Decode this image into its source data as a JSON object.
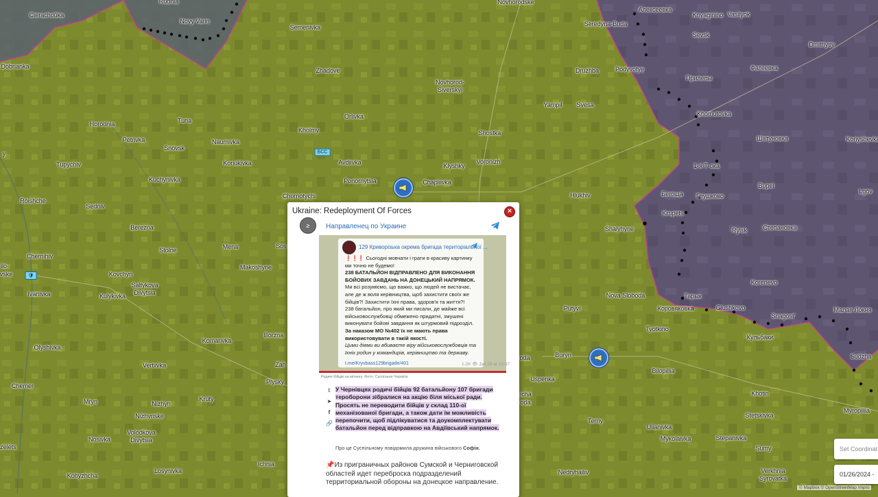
{
  "map": {
    "colors": {
      "ukraine_controlled": "#7d8a2e",
      "russia_area": "#5e5670",
      "border": "#c83a9a",
      "frontline_dots": "#0a0a0a"
    },
    "towns": [
      {
        "name": "Cierachoŭka",
        "cyr": false
      },
      {
        "name": "Rudnia",
        "cyr": false
      },
      {
        "name": "Novy Varin",
        "cyr": false
      },
      {
        "name": "Semenivka",
        "cyr": false
      },
      {
        "name": "Novhorodske",
        "cyr": false
      },
      {
        "name": "Seredyna-Buda",
        "cyr": false
      },
      {
        "name": "Алексеевка",
        "cyr": true
      },
      {
        "name": "Knyaginino",
        "cyr": false
      },
      {
        "name": "Vasilyok",
        "cyr": false
      },
      {
        "name": "Sevsk",
        "cyr": false
      },
      {
        "name": "Dmitriyev",
        "cyr": false
      },
      {
        "name": "Dobrianka",
        "cyr": false
      },
      {
        "name": "Zhadove",
        "cyr": false
      },
      {
        "name": "Novhorod-",
        "cyr": false
      },
      {
        "name": "Siverskyi",
        "cyr": false
      },
      {
        "name": "Druzhba",
        "cyr": false
      },
      {
        "name": "Podyvotye",
        "cyr": false
      },
      {
        "name": "Фатеевка",
        "cyr": true
      },
      {
        "name": "Прилепы",
        "cyr": true
      },
      {
        "name": "Yampil",
        "cyr": false
      },
      {
        "name": "Svesa",
        "cyr": false
      },
      {
        "name": "Khomutovka",
        "cyr": false
      },
      {
        "name": "Orlivka",
        "cyr": false
      },
      {
        "name": "Horodnia",
        "cyr": false
      },
      {
        "name": "Turia",
        "cyr": false
      },
      {
        "name": "Kholmy",
        "cyr": false
      },
      {
        "name": "Shostka",
        "cyr": false
      },
      {
        "name": "Шатуновка",
        "cyr": true
      },
      {
        "name": "Konyshevka",
        "cyr": false
      },
      {
        "name": "Petrivka",
        "cyr": false
      },
      {
        "name": "Naumivka",
        "cyr": false
      },
      {
        "name": "Snovsk",
        "cyr": false
      },
      {
        "name": "Koriukivka",
        "cyr": false
      },
      {
        "name": "Avdiivka",
        "cyr": false
      },
      {
        "name": "Klyshky",
        "cyr": false
      },
      {
        "name": "Voronizh",
        "cyr": false
      },
      {
        "name": "1-я Т·ока",
        "cyr": true
      },
      {
        "name": "Tupychiv",
        "cyr": false
      },
      {
        "name": "Ponornytsia",
        "cyr": false
      },
      {
        "name": "Chapliivka",
        "cyr": false
      },
      {
        "name": "Kuchynivka",
        "cyr": false
      },
      {
        "name": "Bupel",
        "cyr": false
      },
      {
        "name": "Глушково",
        "cyr": true
      },
      {
        "name": "Chornotychi",
        "cyr": false
      },
      {
        "name": "Hlukhiv",
        "cyr": false
      },
      {
        "name": "Бегоща",
        "cyr": true
      },
      {
        "name": "Lgov",
        "cyr": false
      },
      {
        "name": "Roishche",
        "cyr": false
      },
      {
        "name": "Sedniv",
        "cyr": false
      },
      {
        "name": "Krupets",
        "cyr": false
      },
      {
        "name": "Rylsk",
        "cyr": false
      },
      {
        "name": "Berezna",
        "cyr": false
      },
      {
        "name": "Shalyhyne",
        "cyr": false
      },
      {
        "name": "Степановка",
        "cyr": true
      },
      {
        "name": "Chernihiv",
        "cyr": false
      },
      {
        "name": "Mena",
        "cyr": false
      },
      {
        "name": "Sos",
        "cyr": false
      },
      {
        "name": "Stolne",
        "cyr": false
      },
      {
        "name": "Kovchyn",
        "cyr": false
      },
      {
        "name": "Makoshyne",
        "cyr": false
      },
      {
        "name": "Saltykova",
        "cyr": false
      },
      {
        "name": "Divytsia",
        "cyr": false
      },
      {
        "name": "Kulykivka",
        "cyr": false
      },
      {
        "name": "Ivanivka",
        "cyr": false
      },
      {
        "name": "Korenevo",
        "cyr": false
      },
      {
        "name": "Nova Sloboda",
        "cyr": false
      },
      {
        "name": "Тарык",
        "cyr": true
      },
      {
        "name": "Glushkovo",
        "cyr": false
      },
      {
        "name": "Putyvl",
        "cyr": false
      },
      {
        "name": "Коровяковка",
        "cyr": true
      },
      {
        "name": "Малая Локня",
        "cyr": true
      },
      {
        "name": "Snagost'",
        "cyr": false
      },
      {
        "name": "Кульбаки",
        "cyr": true
      },
      {
        "name": "Tyotkino",
        "cyr": false
      },
      {
        "name": "Olyshivka",
        "cyr": false
      },
      {
        "name": "Komarivka",
        "cyr": false
      },
      {
        "name": "Borzna",
        "cyr": false
      },
      {
        "name": "Zah",
        "cyr": false
      },
      {
        "name": "Vertiivka",
        "cyr": false
      },
      {
        "name": "Buryn",
        "cyr": false
      },
      {
        "name": "Sudzha",
        "cyr": false
      },
      {
        "name": "Bilopillia",
        "cyr": false
      },
      {
        "name": "Chemer",
        "cyr": false
      },
      {
        "name": "Mryn",
        "cyr": false
      },
      {
        "name": "Nizhyn",
        "cyr": false
      },
      {
        "name": "Krutу",
        "cyr": false
      },
      {
        "name": "Plysky",
        "cyr": false
      },
      {
        "name": "Uspenka",
        "cyr": false
      },
      {
        "name": "Khotin",
        "cyr": false
      },
      {
        "name": "Nizhynske",
        "cyr": false
      },
      {
        "name": "Stetskivka",
        "cyr": false
      },
      {
        "name": "Myropillia",
        "cyr": false
      },
      {
        "name": "Terny",
        "cyr": false
      },
      {
        "name": "Nosivka",
        "cyr": false
      },
      {
        "name": "Volodkova",
        "cyr": false
      },
      {
        "name": "Divytsia",
        "cyr": false
      },
      {
        "name": "Ulianivka",
        "cyr": false
      },
      {
        "name": "Mykolaivka",
        "cyr": false
      },
      {
        "name": "Stepanivka",
        "cyr": false
      },
      {
        "name": "Sumy",
        "cyr": false
      },
      {
        "name": "Losynivka",
        "cyr": false
      },
      {
        "name": "Ichnia",
        "cyr": false
      },
      {
        "name": "Kobyzhcha",
        "cyr": false
      },
      {
        "name": "Nedryhailiv",
        "cyr": false
      },
      {
        "name": "Verkhnia",
        "cyr": false
      },
      {
        "name": "Syrovatka",
        "cyr": false
      },
      {
        "name": "zelets",
        "cyr": false
      },
      {
        "name": "ilo-",
        "cyr": false
      },
      {
        "name": "vske",
        "cyr": false
      },
      {
        "name": "echa",
        "cyr": false
      },
      {
        "name": "oda",
        "cyr": false
      },
      {
        "name": "odа",
        "cyr": false
      },
      {
        "name": "y",
        "cyr": false
      }
    ],
    "road_signs": [
      "БСС"
    ],
    "pins": [
      "megaphone-pin-chapliivka",
      "megaphone-pin-buryn"
    ]
  },
  "popup": {
    "title": "Ukraine: Redeployment Of Forces",
    "close_label": "×",
    "channel_avatar": "≥",
    "channel_name": "Направленец по Украине",
    "image": {
      "card_title": "129 Криворізька окрема бригада територіальної ...",
      "lines": [
        {
          "text": "❗❗❗ Сьогодні мовчати і грати в красиву картинку",
          "style": ""
        },
        {
          "text": "ми точно не будемо!",
          "style": ""
        },
        {
          "text": "238 БАТАЛЬЙОН ВІДПРАВЛЕНО ДЛЯ ВИКОНАННЯ",
          "style": "b"
        },
        {
          "text": "БОЙОВИХ ЗАВДАНЬ НА ДОНЕЦЬКИЙ НАПРЯМОК.",
          "style": "b"
        },
        {
          "text": "Ми всі розуміємо, що важко, що людей не вистачає,",
          "style": ""
        },
        {
          "text": "але де ж воля керівництва, щоб захистити своїх же",
          "style": ""
        },
        {
          "text": "бійців?! Захистити їхні права, здоров'я та життя?!",
          "style": ""
        },
        {
          "text": "238 батальйон, про який ми писали, де майже всі",
          "style": ""
        },
        {
          "text": "військовослужбовці обмежено придатні, змушені",
          "style": ""
        },
        {
          "text": "виконувати бойові завдання як штурмовий підрозділ.",
          "style": ""
        },
        {
          "text": "За наказом МО №402 їх не мають права",
          "style": "b"
        },
        {
          "text": "використовувати в такій якості.",
          "style": "b"
        },
        {
          "text": "Цими діями ви вбиваєте віру військовослужбовців та",
          "style": "i"
        },
        {
          "text": "їхніх родин у командирів, керівництво та державу.",
          "style": "i"
        }
      ],
      "link": "t.me/Kryvbass129brigade/401",
      "stats": "1.2K 👁 Jan 25 at 15:37",
      "caption": "Родичі бійців на мітингу. Фото: Суспільне Чернігів"
    },
    "share_icons": [
      "twitter-icon",
      "telegram-icon",
      "facebook-icon",
      "link-icon"
    ],
    "body_text": "У Чернівцях родичі бійців 92 батальйону 107 бригади тероборони зібралися на акцію біля міської ради. Просять не переводити бійців у склад 110-ої механізованої бригади, а також дати їм можливість перепочити, щоб підлікуватися та доукомплектувати батальйон перед відправкою на Авдіївський напрямок.",
    "source_line_prefix": "Про це Суспільному повідомила дружина військового",
    "source_line_name": "Софія.",
    "ru_text": "📌Из приграничных районов Сумской и Черниговской областей идет переброска подразделений территориальной обороны на донецкое направление."
  },
  "controls": {
    "coordinates_placeholder": "Set Coordinat",
    "date_value": "01/26/2024 -",
    "attribution": "© Mapbox © OpenStreetMap Impro"
  }
}
